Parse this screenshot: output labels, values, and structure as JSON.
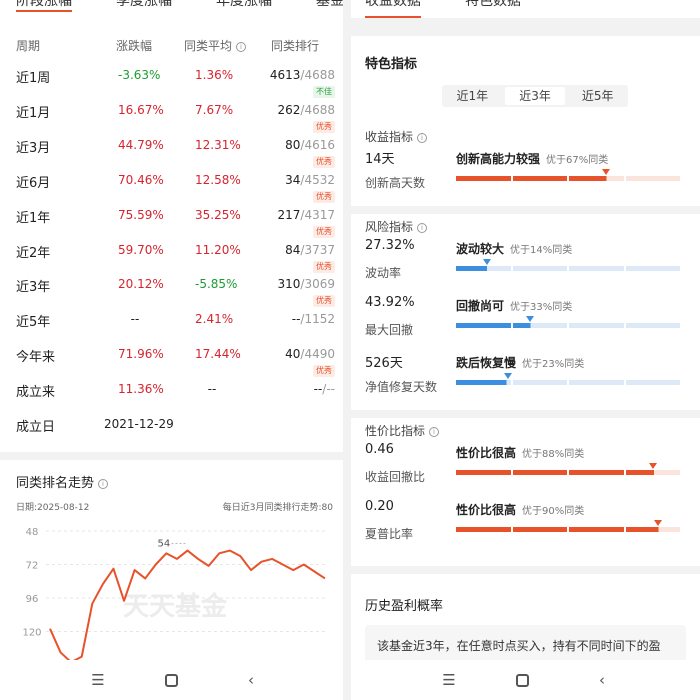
{
  "left": {
    "tabs": [
      "阶段涨幅",
      "季度涨幅",
      "年度涨幅",
      "基金评级"
    ],
    "table_header": [
      "周期",
      "涨跌幅",
      "同类平均",
      "同类排行"
    ],
    "rows": [
      {
        "period": "近1周",
        "change": "-3.63%",
        "change_color": "#1a9e30",
        "avg": "1.36%",
        "avg_color": "#d7242f",
        "rank": "4613",
        "total": "4688",
        "badge": "不佳",
        "badge_type": "bad"
      },
      {
        "period": "近1月",
        "change": "16.67%",
        "change_color": "#d7242f",
        "avg": "7.67%",
        "avg_color": "#d7242f",
        "rank": "262",
        "total": "4688",
        "badge": "优秀",
        "badge_type": "good"
      },
      {
        "period": "近3月",
        "change": "44.79%",
        "change_color": "#d7242f",
        "avg": "12.31%",
        "avg_color": "#d7242f",
        "rank": "80",
        "total": "4616",
        "badge": "优秀",
        "badge_type": "good"
      },
      {
        "period": "近6月",
        "change": "70.46%",
        "change_color": "#d7242f",
        "avg": "12.58%",
        "avg_color": "#d7242f",
        "rank": "34",
        "total": "4532",
        "badge": "优秀",
        "badge_type": "good"
      },
      {
        "period": "近1年",
        "change": "75.59%",
        "change_color": "#d7242f",
        "avg": "35.25%",
        "avg_color": "#d7242f",
        "rank": "217",
        "total": "4317",
        "badge": "优秀",
        "badge_type": "good"
      },
      {
        "period": "近2年",
        "change": "59.70%",
        "change_color": "#d7242f",
        "avg": "11.20%",
        "avg_color": "#d7242f",
        "rank": "84",
        "total": "3737",
        "badge": "优秀",
        "badge_type": "good"
      },
      {
        "period": "近3年",
        "change": "20.12%",
        "change_color": "#d7242f",
        "avg": "-5.85%",
        "avg_color": "#1a9e30",
        "rank": "310",
        "total": "3069",
        "badge": "优秀",
        "badge_type": "good"
      },
      {
        "period": "近5年",
        "change": "--",
        "change_color": "#222222",
        "avg": "2.41%",
        "avg_color": "#d7242f",
        "rank": "--",
        "total": "1152",
        "badge": "",
        "badge_type": ""
      },
      {
        "period": "今年来",
        "change": "71.96%",
        "change_color": "#d7242f",
        "avg": "17.44%",
        "avg_color": "#d7242f",
        "rank": "40",
        "total": "4490",
        "badge": "优秀",
        "badge_type": "good"
      },
      {
        "period": "成立来",
        "change": "11.36%",
        "change_color": "#d7242f",
        "avg": "--",
        "avg_color": "#222222",
        "rank": "--",
        "total": "--",
        "badge": "",
        "badge_type": ""
      }
    ],
    "inception_label": "成立日",
    "inception_date": "2021-12-29",
    "rank_trend_title": "同类排名走势",
    "date_label": "日期:2025-08-12",
    "trend_note": "每日近3月同类排行走势:80",
    "watermark": "天天基金",
    "peak_label": "54"
  },
  "chart_data": {
    "type": "line",
    "title": "同类排名走势",
    "y_ticks": [
      48,
      72,
      96,
      120
    ],
    "ylim": [
      48,
      144
    ],
    "y_inverted": true,
    "series": [
      {
        "values": [
          118,
          135,
          142,
          138,
          100,
          86,
          75,
          98,
          76,
          82,
          72,
          64,
          68,
          62,
          68,
          73,
          64,
          62,
          66,
          76,
          70,
          68,
          72,
          76,
          72,
          77,
          82
        ]
      }
    ]
  },
  "right": {
    "tabs": [
      "收益数据",
      "特色数据"
    ],
    "section_title": "特色指标",
    "periods": [
      "近1年",
      "近3年",
      "近5年"
    ],
    "selected_period": "近3年",
    "groups": [
      {
        "title": "收益指标",
        "metrics": [
          {
            "value": "14天",
            "label": "创新高天数",
            "head": "创新高能力较强",
            "note": "优于67%同类",
            "pct": 67,
            "color": "#e8522a"
          }
        ]
      },
      {
        "title": "风险指标",
        "metrics": [
          {
            "value": "27.32%",
            "label": "波动率",
            "head": "波动较大",
            "note": "优于14%同类",
            "pct": 14,
            "color": "#3b8ee0"
          },
          {
            "value": "43.92%",
            "label": "最大回撤",
            "head": "回撤尚可",
            "note": "优于33%同类",
            "pct": 33,
            "color": "#3b8ee0"
          },
          {
            "value": "526天",
            "label": "净值修复天数",
            "head": "跌后恢复慢",
            "note": "优于23%同类",
            "pct": 23,
            "color": "#3b8ee0"
          }
        ]
      },
      {
        "title": "性价比指标",
        "metrics": [
          {
            "value": "0.46",
            "label": "收益回撤比",
            "head": "性价比很高",
            "note": "优于88%同类",
            "pct": 88,
            "color": "#e8522a"
          },
          {
            "value": "0.20",
            "label": "夏普比率",
            "head": "性价比很高",
            "note": "优于90%同类",
            "pct": 90,
            "color": "#e8522a"
          }
        ]
      }
    ],
    "history_title": "历史盈利概率",
    "history_text": "该基金近3年，在任意时点买入，持有不同时间下的盈"
  },
  "nav": {
    "menu_icon": "menu-icon",
    "home_icon": "home-icon",
    "back_icon": "back-icon"
  }
}
